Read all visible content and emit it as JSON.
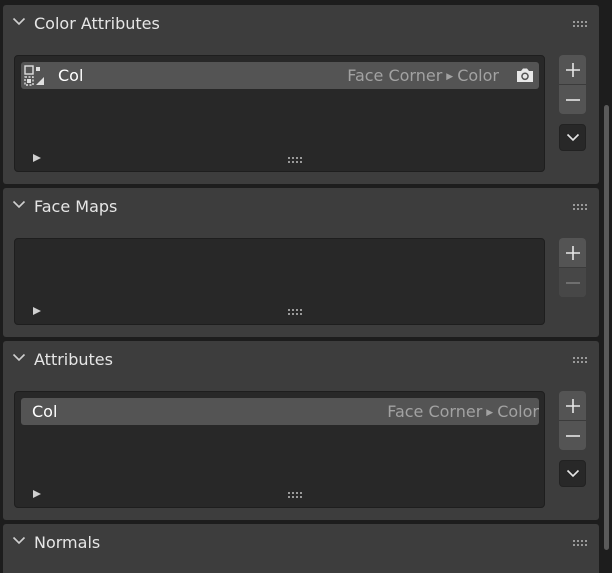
{
  "panels": {
    "color_attributes": {
      "title": "Color Attributes",
      "items": [
        {
          "name": "Col",
          "domain": "Face Corner",
          "type": "Color",
          "active_render": true
        }
      ]
    },
    "face_maps": {
      "title": "Face Maps",
      "items": []
    },
    "attributes": {
      "title": "Attributes",
      "items": [
        {
          "name": "Col",
          "domain": "Face Corner",
          "type": "Color"
        }
      ]
    },
    "normals": {
      "title": "Normals"
    }
  },
  "icons": {
    "collapse": "chevron-down-icon",
    "grip": "drag-grip-icon",
    "color_attribute": "color-attribute-icon",
    "render": "camera-icon",
    "add": "plus-icon",
    "remove": "minus-icon",
    "menu": "chevron-down-icon",
    "expand": "triangle-right-icon"
  },
  "colors": {
    "panel_bg": "#3d3d3d",
    "list_bg": "#282828",
    "row_active": "#545454",
    "text": "#e6e6e6",
    "text_dim": "#a2a2a2"
  }
}
